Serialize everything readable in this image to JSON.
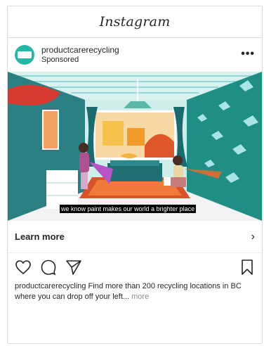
{
  "app": {
    "title": "Instagram"
  },
  "post": {
    "account": "productcarerecycling",
    "label": "Sponsored",
    "options": "•••",
    "subtitle": "we know paint makes our world a brighter place",
    "cta": "Learn more",
    "cta_arrow": "›",
    "caption_user": "productcarerecycling",
    "caption_text": " Find more than 200 recycling locations in BC where you can drop off your left...",
    "caption_more": "more"
  },
  "icons": [
    "heart-icon",
    "comment-icon",
    "share-icon",
    "bookmark-icon",
    "chevron-right-icon",
    "more-options-icon"
  ],
  "colors": {
    "accent": "#23b7a5",
    "wall_left": "#2a7f82",
    "wall_right": "#1f8f86",
    "floor": "#f4f4f4"
  }
}
